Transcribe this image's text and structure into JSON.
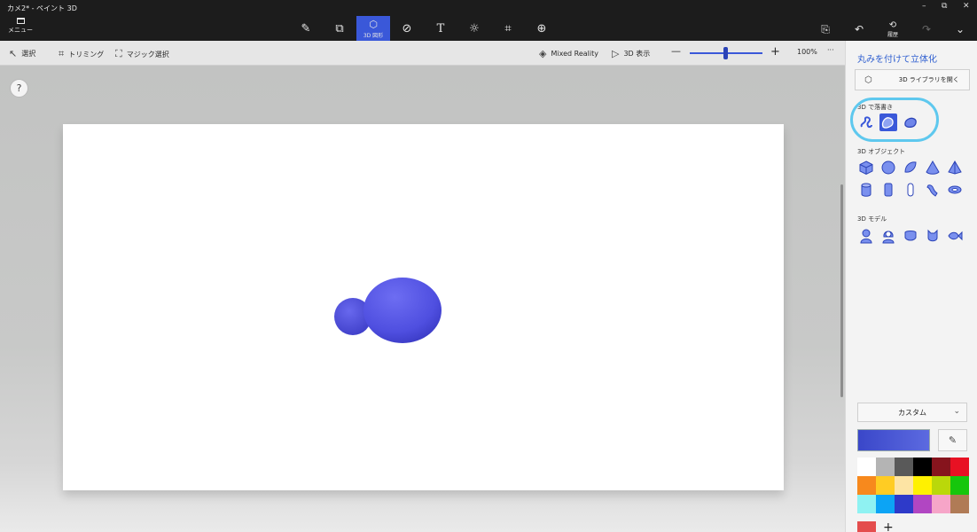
{
  "window": {
    "title": "カメ2* - ペイント 3D"
  },
  "menu": {
    "label": "メニュー"
  },
  "top_tools": [
    {
      "name": "brushes-tool",
      "glyph": "✎",
      "label": ""
    },
    {
      "name": "2d-shapes-tool",
      "glyph": "⧉",
      "label": ""
    },
    {
      "name": "3d-shapes-tool",
      "glyph": "⬡",
      "label": "3D 図形"
    },
    {
      "name": "stickers-tool",
      "glyph": "⊘",
      "label": ""
    },
    {
      "name": "text-tool",
      "glyph": "T",
      "label": ""
    },
    {
      "name": "effects-tool",
      "glyph": "☼",
      "label": ""
    },
    {
      "name": "canvas-tool",
      "glyph": "⌗",
      "label": ""
    },
    {
      "name": "3d-library-tool",
      "glyph": "⊕",
      "label": ""
    }
  ],
  "right_actions": {
    "paste_glyph": "⎘",
    "undo_glyph": "↶",
    "history_glyph": "⟲",
    "history_label": "履歴",
    "redo_glyph": "↷",
    "expand_glyph": "⌄"
  },
  "window_controls": {
    "minimize": "–",
    "maximize": "⧉",
    "close": "✕"
  },
  "subbar": {
    "select": "選択",
    "crop": "トリミング",
    "magic_select": "マジック選択",
    "mixed_reality": "Mixed Reality",
    "view_3d": "3D 表示",
    "zoom_minus": "—",
    "zoom_plus": "+",
    "zoom_level": "100%",
    "more": "···"
  },
  "help": {
    "glyph": "?"
  },
  "panel": {
    "title": "丸みを付けて立体化",
    "library_button": "3D ライブラリを開く",
    "doodle_section": "3D で落書き",
    "objects_section": "3D オブジェクト",
    "models_section": "3D モデル",
    "color_dropdown": "カスタム",
    "color_dropdown_chevron": "⌄",
    "eyedropper_glyph": "✎",
    "add_color": "+"
  },
  "colors": {
    "accent": "#3a58d9",
    "shape_blue": "#5656e6",
    "palette": [
      "#ffffff",
      "#b4b4b4",
      "#595959",
      "#000000",
      "#86141d",
      "#e81123",
      "#f7891d",
      "#ffcc23",
      "#fde4a4",
      "#fff100",
      "#bad80a",
      "#16c60c",
      "#8ff2f2",
      "#0ca4f5",
      "#2e3ac9",
      "#b146c2",
      "#f6a5c8",
      "#b07b56"
    ]
  }
}
